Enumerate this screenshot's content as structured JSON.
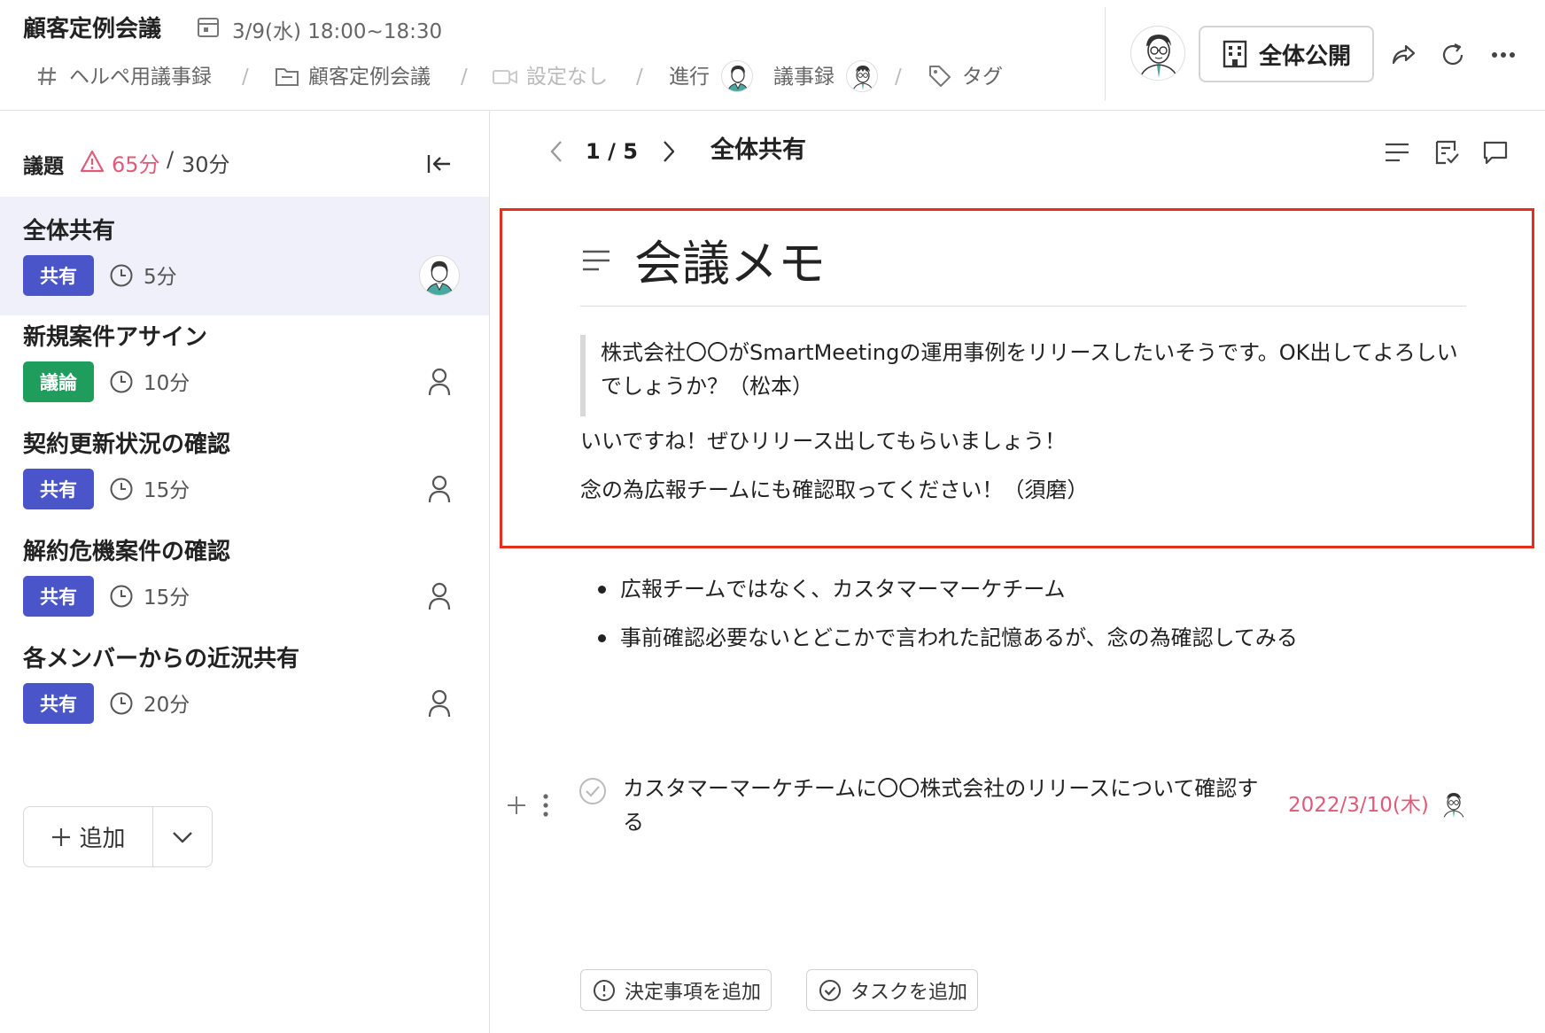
{
  "header": {
    "meeting_title": "顧客定例会議",
    "date_time": "3/9(水) 18:00~18:30",
    "breadcrumbs": {
      "channel": "ヘルペ用議事録",
      "folder": "顧客定例会議",
      "video": "設定なし",
      "facilitator_label": "進行",
      "minutes_label": "議事録",
      "tag": "タグ",
      "separator": "/"
    },
    "visibility_button": "全体公開",
    "icons": [
      "calendar-icon",
      "hash-icon",
      "folder-icon",
      "video-icon",
      "tag-icon",
      "building-icon",
      "share-icon",
      "refresh-icon",
      "more-icon"
    ]
  },
  "sidebar": {
    "agenda_label": "議題",
    "time_over": "65分",
    "time_separator": "/",
    "time_total": "30分",
    "items": [
      {
        "title": "全体共有",
        "badge": "共有",
        "duration": "5分"
      },
      {
        "title": "新規案件アサイン",
        "badge": "議論",
        "duration": "10分"
      },
      {
        "title": "契約更新状況の確認",
        "badge": "共有",
        "duration": "15分"
      },
      {
        "title": "解約危機案件の確認",
        "badge": "共有",
        "duration": "15分"
      },
      {
        "title": "各メンバーからの近況共有",
        "badge": "共有",
        "duration": "20分"
      }
    ],
    "add_button": "追加",
    "colors": {
      "share_badge": "#4a55c9",
      "discuss_badge": "#1f9d5c",
      "warning": "#e05a7a",
      "active_row": "#eff0fa"
    }
  },
  "main": {
    "pager_current": "1",
    "pager_separator": "/",
    "pager_total": "5",
    "topic_title": "全体共有",
    "memo_heading": "会議メモ",
    "quote": "株式会社〇〇がSmartMeetingの運用事例をリリースしたいそうです。OK出してよろしいでしょうか？（松本）",
    "reply_1": "いいですね！ぜひリリース出してもらいましょう！",
    "reply_2": "念の為広報チームにも確認取ってください！（須磨）",
    "bullets": [
      "広報チームではなく、カスタマーマーケチーム",
      "事前確認必要ないとどこかで言われた記憶あるが、念の為確認してみる"
    ],
    "task": {
      "text": "カスタマーマーケチームに〇〇株式会社のリリースについて確認する",
      "due_date": "2022/3/10(木)"
    },
    "add_decision_button": "決定事項を追加",
    "add_task_button": "タスクを追加",
    "highlight_color": "#e52d20"
  }
}
